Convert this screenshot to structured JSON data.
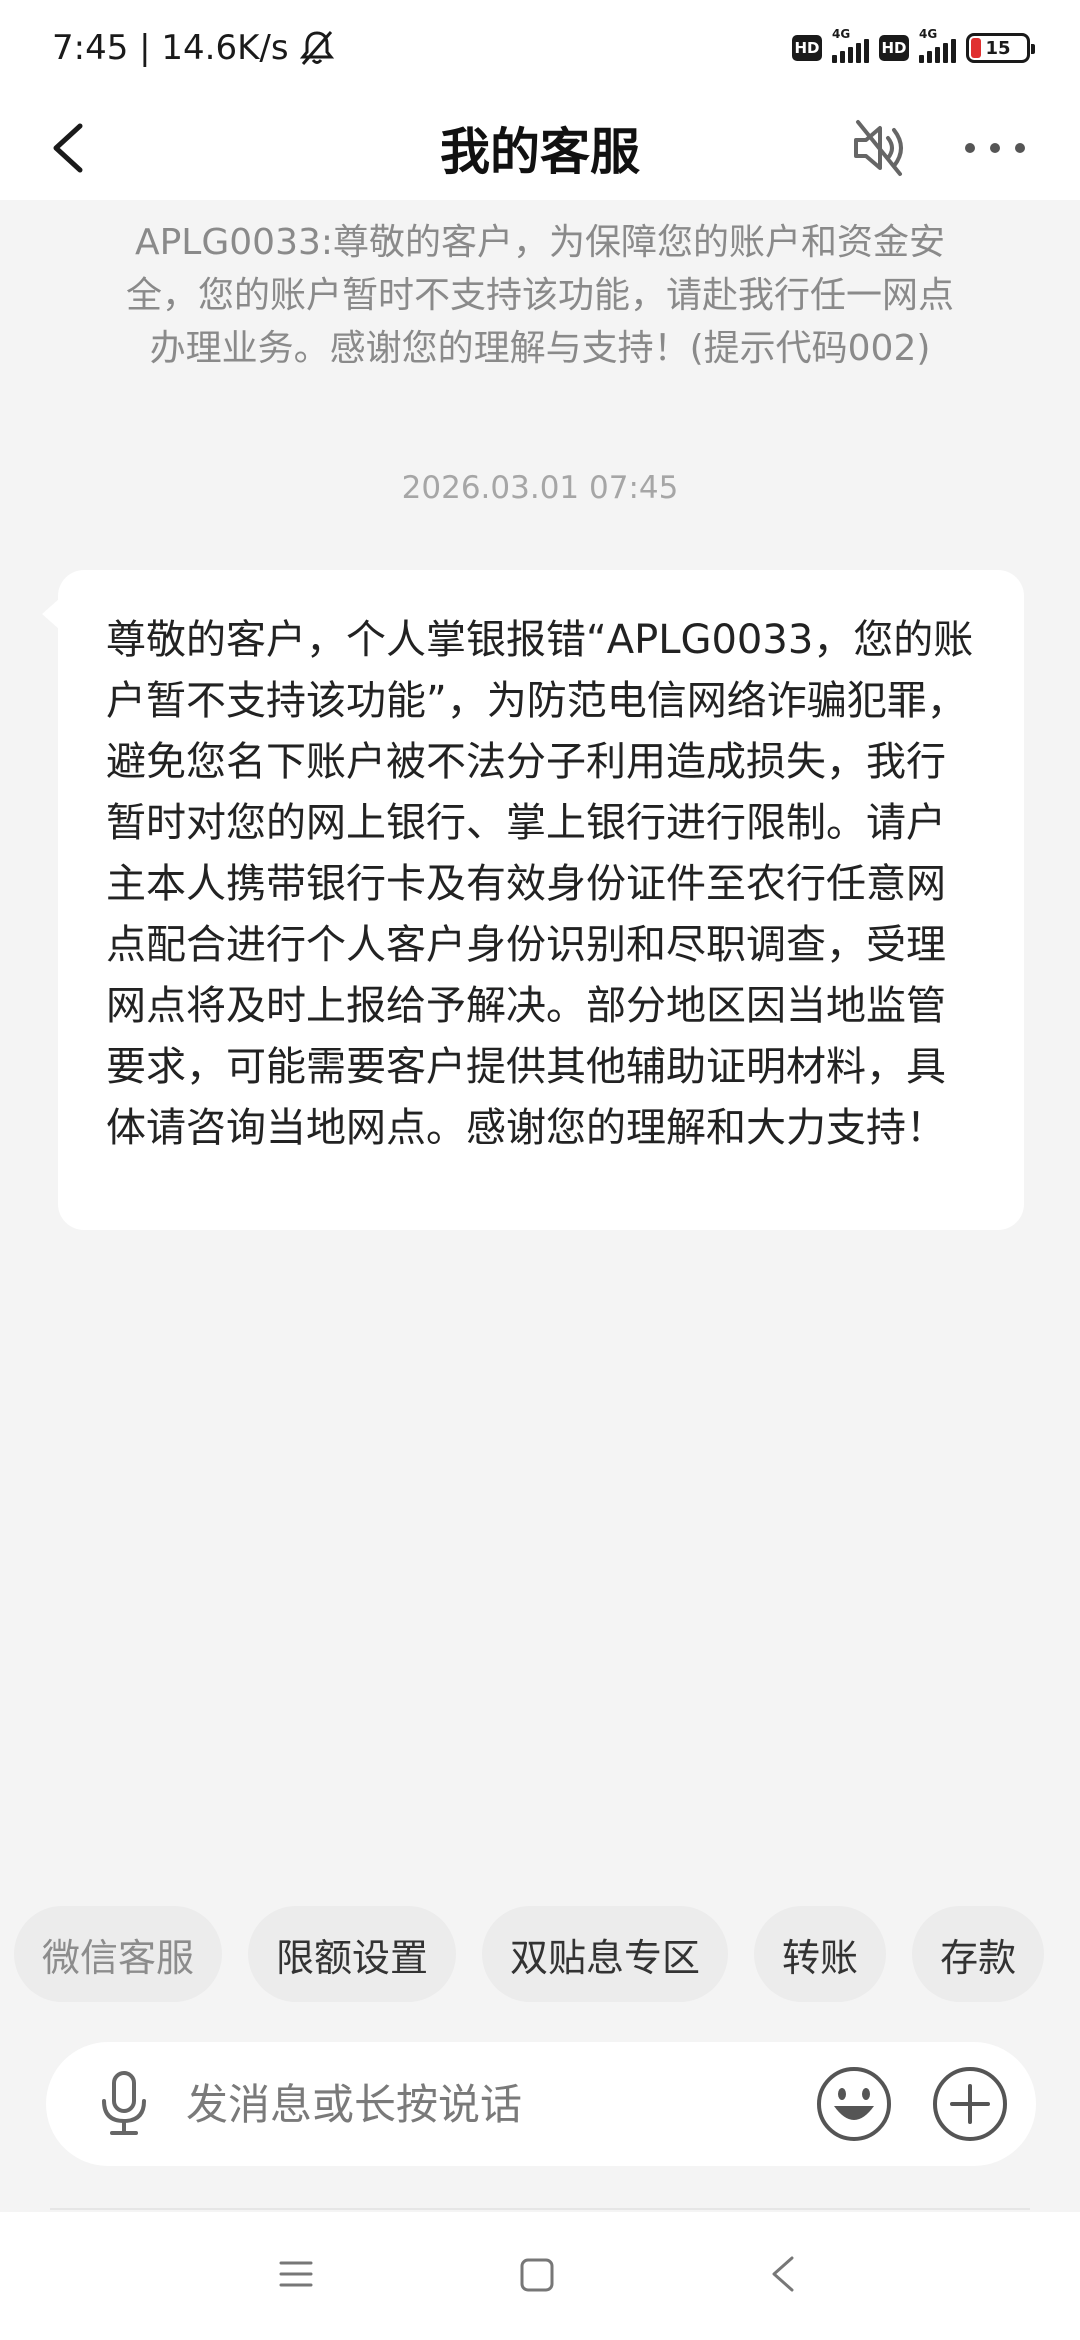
{
  "status_bar": {
    "time_speed": "7:45 | 14.6K/s",
    "hd_label": "HD",
    "network_label": "4G",
    "battery_level": "15"
  },
  "header": {
    "title": "我的客服"
  },
  "messages": {
    "system_notice": "APLG0033:尊敬的客户，为保障您的账户和资金安全，您的账户暂时不支持该功能，请赴我行任一网点办理业务。感谢您的理解与支持！(提示代码002)",
    "timestamp": "2026.03.01 07:45",
    "reply": "尊敬的客户，个人掌银报错“APLG0033，您的账户暂不支持该功能”，为防范电信网络诈骗犯罪，避免您名下账户被不法分子利用造成损失，我行暂时对您的网上银行、掌上银行进行限制。请户主本人携带银行卡及有效身份证件至农行任意网点配合进行个人客户身份识别和尽职调查，受理网点将及时上报给予解决。部分地区因当地监管要求，可能需要客户提供其他辅助证明材料，具体请咨询当地网点。感谢您的理解和大力支持！"
  },
  "quick_replies": [
    "微信客服",
    "限额设置",
    "双贴息专区",
    "转账",
    "存款"
  ],
  "input": {
    "placeholder": "发消息或长按说话"
  },
  "colors": {
    "accent_battery": "#e03030",
    "background": "#f4f4f4",
    "bubble": "#ffffff"
  }
}
